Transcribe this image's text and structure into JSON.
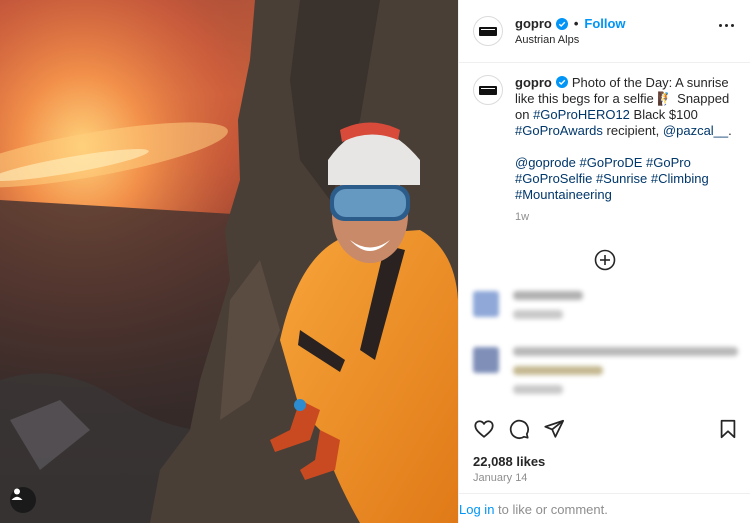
{
  "post": {
    "username": "gopro",
    "follow_label": "Follow",
    "separator": "•",
    "location": "Austrian Alps",
    "caption": {
      "username": "gopro",
      "text_1": "Photo of the Day: A sunrise like this begs for a selfie ",
      "emoji": "🧗",
      "text_2": " Snapped on ",
      "tag_hero": "#GoProHERO12",
      "text_3": " Black $100 ",
      "tag_awards": "#GoProAwards",
      "text_4": " recipient, ",
      "mention": "@pazcal__",
      "text_5": ".",
      "hashtags": [
        "@goprode",
        "#GoProDE",
        "#GoPro",
        "#GoProSelfie",
        "#Sunrise",
        "#Climbing",
        "#Mountaineering"
      ],
      "time_ago": "1w"
    },
    "likes": "22,088 likes",
    "date": "January 14",
    "login_link": "Log in",
    "login_rest": " to like or comment."
  },
  "icons": {
    "more": "more-options-icon",
    "verified": "verified-badge-icon",
    "load_more": "plus-circle-icon",
    "like": "heart-icon",
    "comment": "comment-icon",
    "share": "share-icon",
    "save": "bookmark-icon",
    "user_tag": "person-icon"
  },
  "colors": {
    "link_blue": "#0095f6",
    "hashtag": "#00376b",
    "muted": "#8e8e8e",
    "verified": "#0095f6"
  }
}
